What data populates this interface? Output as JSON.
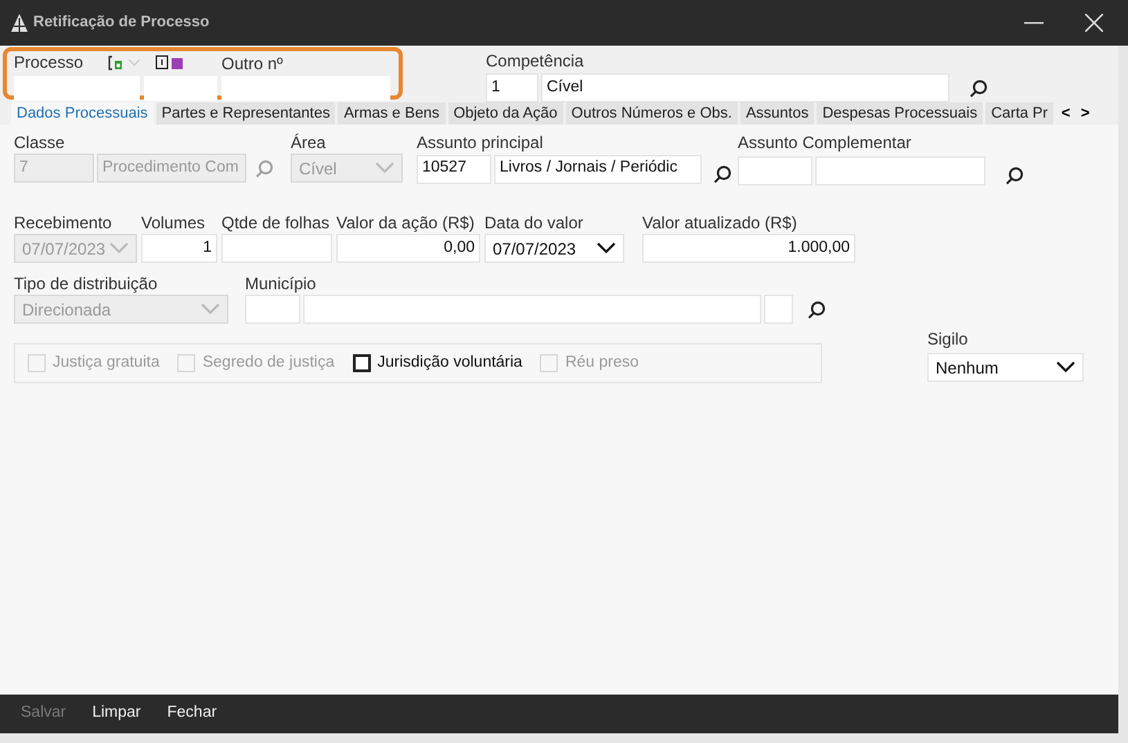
{
  "window": {
    "title": "Retificação de Processo"
  },
  "header": {
    "processo_label": "Processo",
    "outro_label": "Outro nº",
    "competencia_label": "Competência",
    "competencia_code": "1",
    "competencia_name": "Cível"
  },
  "tabs": [
    {
      "label": "Dados Processuais",
      "selected": true
    },
    {
      "label": "Partes e Representantes",
      "selected": false
    },
    {
      "label": "Armas e Bens",
      "selected": false
    },
    {
      "label": "Objeto da Ação",
      "selected": false
    },
    {
      "label": "Outros Números e Obs.",
      "selected": false
    },
    {
      "label": "Assuntos",
      "selected": false
    },
    {
      "label": "Despesas Processuais",
      "selected": false
    },
    {
      "label": "Carta Pr",
      "selected": false
    }
  ],
  "tab_scroll": [
    "<",
    ">"
  ],
  "classe": {
    "label": "Classe",
    "code": "7",
    "name": "Procedimento Com",
    "disabled": true
  },
  "area": {
    "label": "Área",
    "value": "Cível",
    "disabled": true
  },
  "assunto_principal": {
    "label": "Assunto principal",
    "code": "10527",
    "name": "Livros / Jornais / Periódic"
  },
  "assunto_complementar": {
    "label": "Assunto Complementar"
  },
  "row2": [
    {
      "label": "Recebimento",
      "value": "07/07/2023",
      "kind": "dropdown",
      "disabled": true
    },
    {
      "label": "Volumes",
      "value": "1",
      "kind": "number",
      "disabled": false
    },
    {
      "label": "Qtde de folhas",
      "kind": "number",
      "disabled": false
    },
    {
      "label": "Valor da ação (R$)",
      "value": "0,00",
      "kind": "number",
      "disabled": false
    },
    {
      "label": "Data do valor",
      "value": "07/07/2023",
      "kind": "dropdown",
      "disabled": false
    },
    {
      "label": "Valor atualizado (R$)",
      "value": "1.000,00",
      "kind": "number",
      "disabled": false
    }
  ],
  "tipo_distribuicao": {
    "label": "Tipo de distribuição",
    "value": "Direcionada",
    "disabled": true
  },
  "municipio": {
    "label": "Município"
  },
  "checkboxes": [
    {
      "label": "Justiça gratuita",
      "checked": false,
      "disabled": true
    },
    {
      "label": "Segredo de justiça",
      "checked": false,
      "disabled": true
    },
    {
      "label": "Jurisdição voluntária",
      "checked": false,
      "disabled": false
    },
    {
      "label": "Réu preso",
      "checked": false,
      "disabled": true
    }
  ],
  "sigilo": {
    "label": "Sigilo",
    "value": "Nenhum"
  },
  "footer": [
    {
      "label": "Salvar",
      "disabled": true
    },
    {
      "label": "Limpar",
      "disabled": false
    },
    {
      "label": "Fechar",
      "disabled": false
    }
  ]
}
